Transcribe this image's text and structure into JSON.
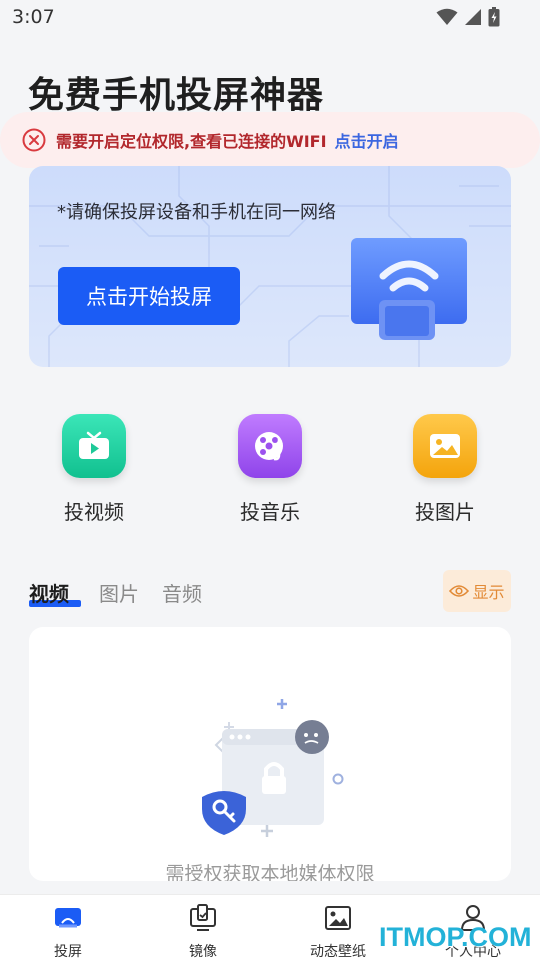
{
  "status_bar": {
    "time": "3:07",
    "icons": [
      "wifi-icon",
      "signal-icon",
      "battery-icon"
    ]
  },
  "app": {
    "title": "免费手机投屏神器"
  },
  "warning": {
    "icon": "close-circle-icon",
    "text": "需要开启定位权限,查看已连接的WIFI",
    "link": "点击开启",
    "color": "#b2272c",
    "link_color": "#3b66e0"
  },
  "banner": {
    "hint": "*请确保投屏设备和手机在同一网络",
    "start_button": "点击开始投屏",
    "accent": "#1b5cf5"
  },
  "features": [
    {
      "label": "投视频",
      "icon": "tv-icon",
      "color": "#1fd0a0"
    },
    {
      "label": "投音乐",
      "icon": "music-disc-icon",
      "color": "#a45cf0"
    },
    {
      "label": "投图片",
      "icon": "image-icon",
      "color": "#f6b423"
    }
  ],
  "media_tabs": {
    "tabs": [
      "视频",
      "图片",
      "音频"
    ],
    "active": "视频",
    "show_button": "显示",
    "show_icon": "eye-icon"
  },
  "media_card": {
    "empty_text": "需授权获取本地媒体权限"
  },
  "bottom_nav": {
    "items": [
      {
        "label": "投屏",
        "icon": "cast-screen-icon",
        "active": true
      },
      {
        "label": "镜像",
        "icon": "mirror-icon",
        "active": false
      },
      {
        "label": "动态壁纸",
        "icon": "wallpaper-icon",
        "active": false
      },
      {
        "label": "个人中心",
        "icon": "user-icon",
        "active": false
      }
    ]
  },
  "watermark": {
    "text": "ITMOP.COM"
  }
}
